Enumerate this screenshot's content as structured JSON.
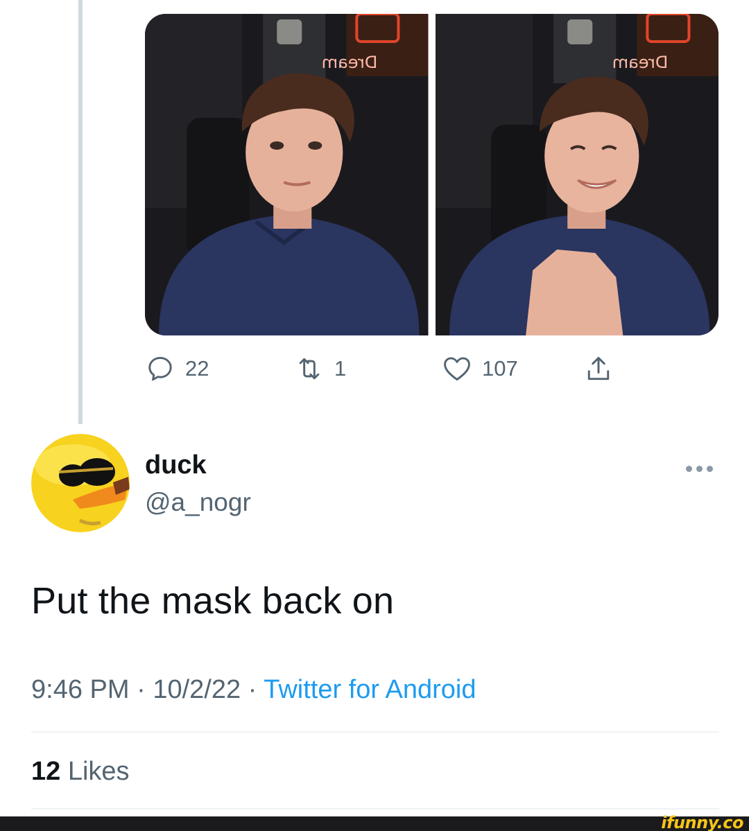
{
  "thread": {
    "media": [
      {
        "sign_text": "Dream",
        "description_icon": "photo"
      },
      {
        "sign_text": "Dream",
        "description_icon": "photo"
      }
    ],
    "actions": {
      "reply_count": "22",
      "retweet_count": "1",
      "like_count": "107"
    }
  },
  "tweet": {
    "display_name": "duck",
    "handle": "@a_nogr",
    "text": "Put the mask back on",
    "time": "9:46 PM",
    "date": "10/2/22",
    "separator": "·",
    "source": "Twitter for Android",
    "likes_count": "12",
    "likes_label": "Likes"
  },
  "watermark": "ifunny.co",
  "colors": {
    "accent": "#1d9bf0",
    "secondary_text": "#536471",
    "primary_text": "#0f1419",
    "divider": "#eff3f4",
    "thread_line": "#cfd9de"
  }
}
